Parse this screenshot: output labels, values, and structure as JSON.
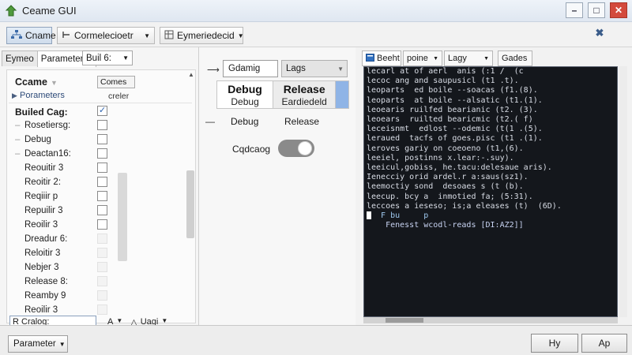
{
  "window": {
    "title": "Ceame GUI",
    "minimize": "–",
    "maximize": "□",
    "close": "✕"
  },
  "toolbar": {
    "btn1_label": "Cname",
    "btn2_label": "Cormelecioetr",
    "btn3_label": "Eymeriedecid",
    "pin_glyph": "✖"
  },
  "left": {
    "tabs": [
      "Eymeo",
      "Parameterss"
    ],
    "tab_dropdown": "Buil 6:",
    "tree_header": "Ccame",
    "col_header": "Comes",
    "row2_label": "Porameters",
    "row2_value": "creler",
    "group_label": "Builed Cag:",
    "items": [
      {
        "label": "Rosetiersg:",
        "dash": true
      },
      {
        "label": "Debug",
        "dash": true
      },
      {
        "label": "Deactan16:",
        "dash": true
      },
      {
        "label": "Reouitir 3",
        "dash": false
      },
      {
        "label": "Reoitir 2:",
        "dash": false
      },
      {
        "label": "Reqiiir p",
        "dash": false
      },
      {
        "label": "Repuilir 3",
        "dash": false
      },
      {
        "label": "Reoilir 3",
        "dash": false
      },
      {
        "label": "Dreadur 6:",
        "dash": false
      },
      {
        "label": "Reloitir 3",
        "dash": false
      },
      {
        "label": "Nebjer 3",
        "dash": false
      },
      {
        "label": "Release 8:",
        "dash": false
      },
      {
        "label": "Reamby 9",
        "dash": false
      },
      {
        "label": "Reoilir 3",
        "dash": false
      }
    ],
    "footer_input": "R Cralog:",
    "footer_tool_a": "A",
    "footer_tool_b": "Uagi"
  },
  "middle": {
    "input_value": "Gdamig",
    "combo_value": "Lags",
    "col1_big": "Debug",
    "col1_small": "Debug",
    "col2_big": "Release",
    "col2_small": "Eardiedeld",
    "row_debug": "Debug",
    "row_release": "Release",
    "toggle_label": "Cqdcaog",
    "toggle_on": true
  },
  "right": {
    "tabs": [
      "Beeht",
      "poine",
      "Lagy",
      "Gades"
    ],
    "terminal_lines": [
      "lecarl at of aerl  anis (:1 /  (c",
      "lecoc ang and saupusicl (t1 .t).",
      "leoparts  ed boile --soacas (f1.(8).",
      "leoparts  at boile --alsatic (t1.(1).",
      "leoearis ruilfed bearianic (t2. (3).",
      "leoears  ruilted bearicmic (t2.( f)",
      "leceisnmt  edlost --odemic (t(1 .(5).",
      "leraued  tacfs of goes.pisc (t1 .(1).",
      "leroves gariy on coeoeno (t1,(6).",
      "leeiel, postinns x.lear:-.suy).",
      "leeicul,gobiss, he.tacu:delesaue aris).",
      "Ienecciy orid ardel.r a:saus(sz1).",
      "leemoctiy sond  desoaes s (t (b).",
      "leecup. bcy a  inmotied fa; (5:31).",
      "leccoes a ieseso; is;a eleases (t)  (6D).",
      "  F bu     p",
      "    Fenesst wcodl-reads [DI:AZ2]]"
    ]
  },
  "bottom": {
    "param_label": "Parameter",
    "btn_left": "Hy",
    "btn_right": "Ap"
  }
}
